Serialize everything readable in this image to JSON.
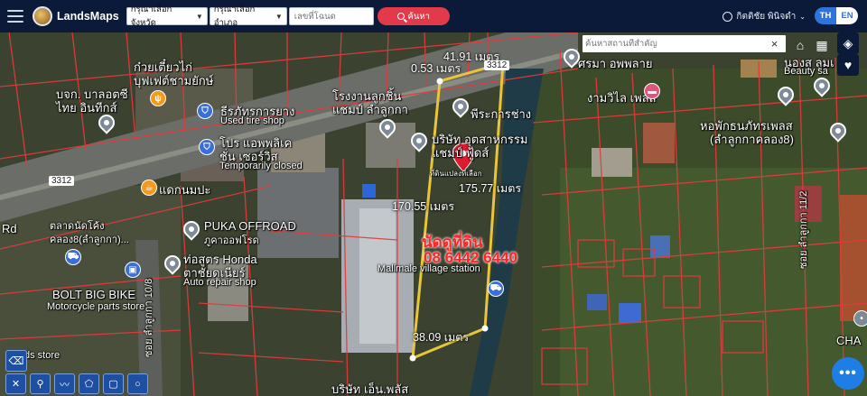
{
  "header": {
    "app_name": "LandsMaps",
    "province_select": "กรุณาเลือกจังหวัด",
    "district_select": "กรุณาเลือกอำเภอ",
    "title_deed_placeholder": "เลขที่โฉนด",
    "search_button": "ค้นหา",
    "user_name": "กิตติชัย พินิจดำ",
    "lang_th": "TH",
    "lang_en": "EN"
  },
  "map": {
    "place_search_placeholder": "ค้นหาสถานที่สำคัญ",
    "clear_label": "×",
    "measurements": [
      "41.91 เมตร",
      "0.53 เมตร",
      "175.77 เมตร",
      "170.55 เมตร",
      "38.09 เมตร"
    ],
    "listing_title": "นัดดูที่ดิน",
    "listing_phone": "08 6442 6440",
    "place_labels": [
      "ก๋วยเตี๋ยวไก่",
      "บุฟเฟต์ชามยักษ์",
      "บจก. บาลอตซี",
      "ไทย อินทีกส์",
      "ธีรภัทรการยาง",
      "Used tire shop",
      "โรงงานลูกชิ้น",
      "แชมป์ ลำลูกกา",
      "พีระการช่าง",
      "ศรมา อพพลาย",
      "งามวิไล เพลส",
      "นองส ลูมเ",
      "Beauty sa",
      "หอพักธนภัทรเพลส",
      "(ลำลูกกาคลอง8)",
      "โปร แอพพลิเค",
      "ชั่น เซอร์วิส",
      "Temporarily closed",
      "บริษัท อุตสาหกรรม",
      "แชมป์ ฟู้ดส์",
      "3312",
      "แดกนมปะ",
      "PUKA OFFROAD",
      "ภูคาออฟโรด",
      "ตลาดนัดโค้ง",
      "คลอง8(ลำลูกกา)...",
      "ท่อสูตร Honda",
      "ตาชัยดูเนียร์",
      "Auto repair shop",
      "BOLT BIG BIKE",
      "Motorcycle parts store",
      "Mallmale village station",
      "ซอย ลำลูกกา 10/8",
      "ซอย ลำลูกกา 11/2",
      "บริษัท เอ็น.พลัส",
      "ds store",
      "Rd",
      "CHA",
      "ที่ดินแปลงที่เลือก"
    ]
  },
  "tools": [
    "ruler-icon",
    "pin-icon",
    "polyline-icon",
    "polygon-icon",
    "rectangle-icon",
    "circle-icon"
  ],
  "fab_label": "•••",
  "colors": {
    "header_bg": "#0c1a3a",
    "search_button": "#e23a4a",
    "parcel_outline": "#e8c53a",
    "cadastral_lines": "#e23b3b",
    "listing_text": "#ff2424",
    "lang_active": "#2f74d8"
  }
}
